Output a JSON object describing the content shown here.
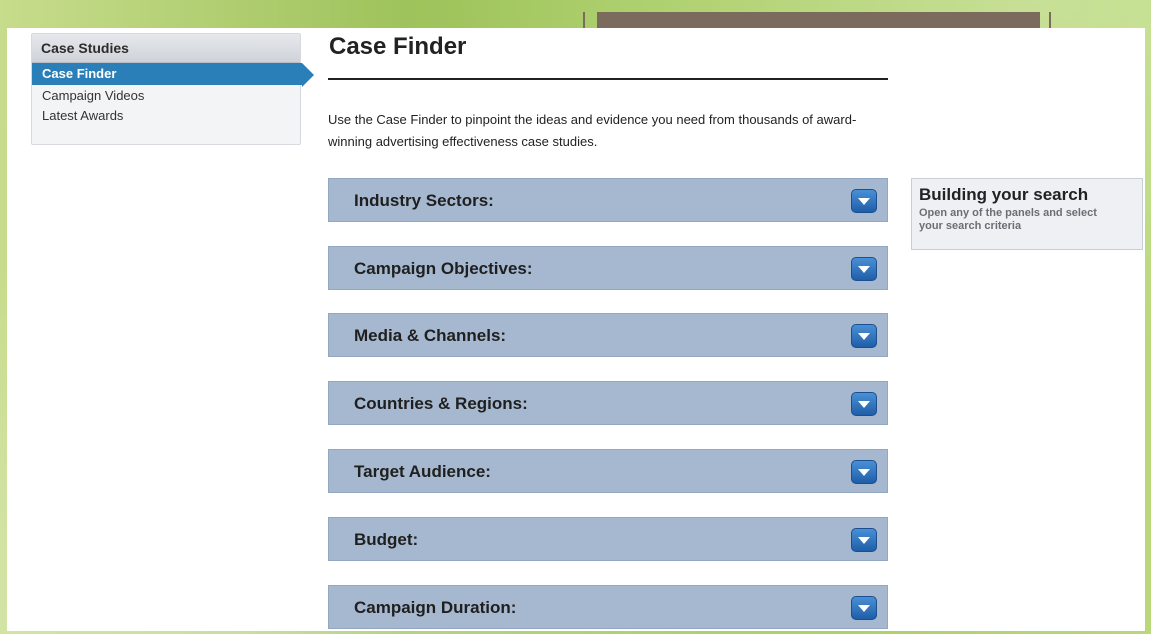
{
  "sidebar": {
    "header": "Case Studies",
    "items": [
      {
        "label": "Case Finder",
        "active": true
      },
      {
        "label": "Campaign Videos",
        "active": false
      },
      {
        "label": "Latest Awards",
        "active": false
      }
    ]
  },
  "main": {
    "title": "Case Finder",
    "intro": "Use the Case Finder to pinpoint the ideas and evidence you need from thousands of award-winning advertising effectiveness case studies.",
    "panels": [
      {
        "label": "Industry Sectors:"
      },
      {
        "label": "Campaign Objectives:"
      },
      {
        "label": "Media & Channels:"
      },
      {
        "label": "Countries & Regions:"
      },
      {
        "label": "Target Audience:"
      },
      {
        "label": "Budget:"
      },
      {
        "label": "Campaign Duration:"
      }
    ]
  },
  "info_box": {
    "title": "Building your search",
    "text": "Open any of the panels and select your search criteria"
  },
  "icons": {
    "panel_toggle": "chevron-down-icon"
  },
  "colors": {
    "active_item": "#2b7fb8",
    "panel_bg": "#a6b8cf",
    "toggle": "#2a6fbd"
  }
}
